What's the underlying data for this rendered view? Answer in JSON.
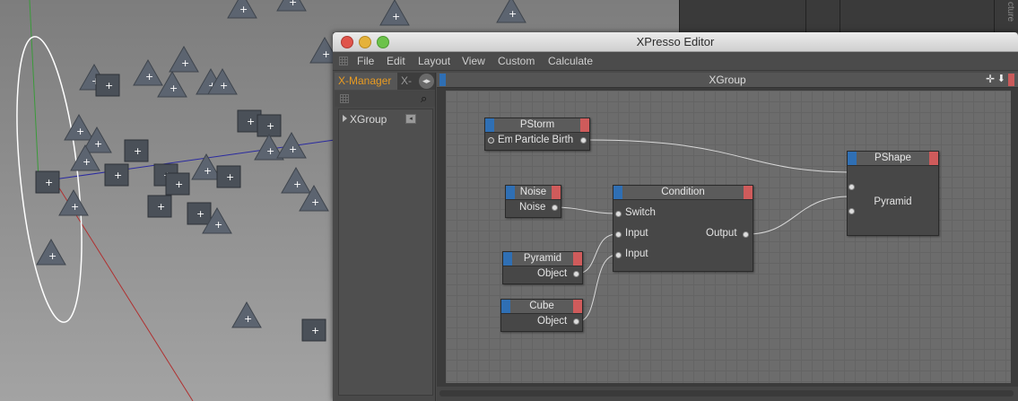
{
  "app": {
    "window_title": "XPresso Editor",
    "menu": [
      "File",
      "Edit",
      "Layout",
      "View",
      "Custom",
      "Calculate"
    ],
    "viewport_side_label": "cture"
  },
  "manager": {
    "tab_active": "X-Manager",
    "tab_other": "X-",
    "tree_item": "XGroup",
    "arrows_glyph": "◂▸",
    "search_glyph": "⌕"
  },
  "editor": {
    "title": "XGroup",
    "move_glyph": "✛",
    "down_glyph": "⬇"
  },
  "nodes": {
    "pstorm": {
      "title": "PStorm",
      "port_left": "Em",
      "port_right": "Particle Birth"
    },
    "noise": {
      "title": "Noise",
      "port": "Noise"
    },
    "pyramid": {
      "title": "Pyramid",
      "port": "Object"
    },
    "cube": {
      "title": "Cube",
      "port": "Object"
    },
    "condition": {
      "title": "Condition",
      "in1": "Switch",
      "in2": "Input",
      "in3": "Input",
      "out": "Output"
    },
    "pshape": {
      "title": "PShape",
      "value": "Pyramid"
    }
  },
  "colors": {
    "node_header_left": "#2f6fb4",
    "node_header_right": "#cf5b5b",
    "active_tab": "#e89b22"
  }
}
